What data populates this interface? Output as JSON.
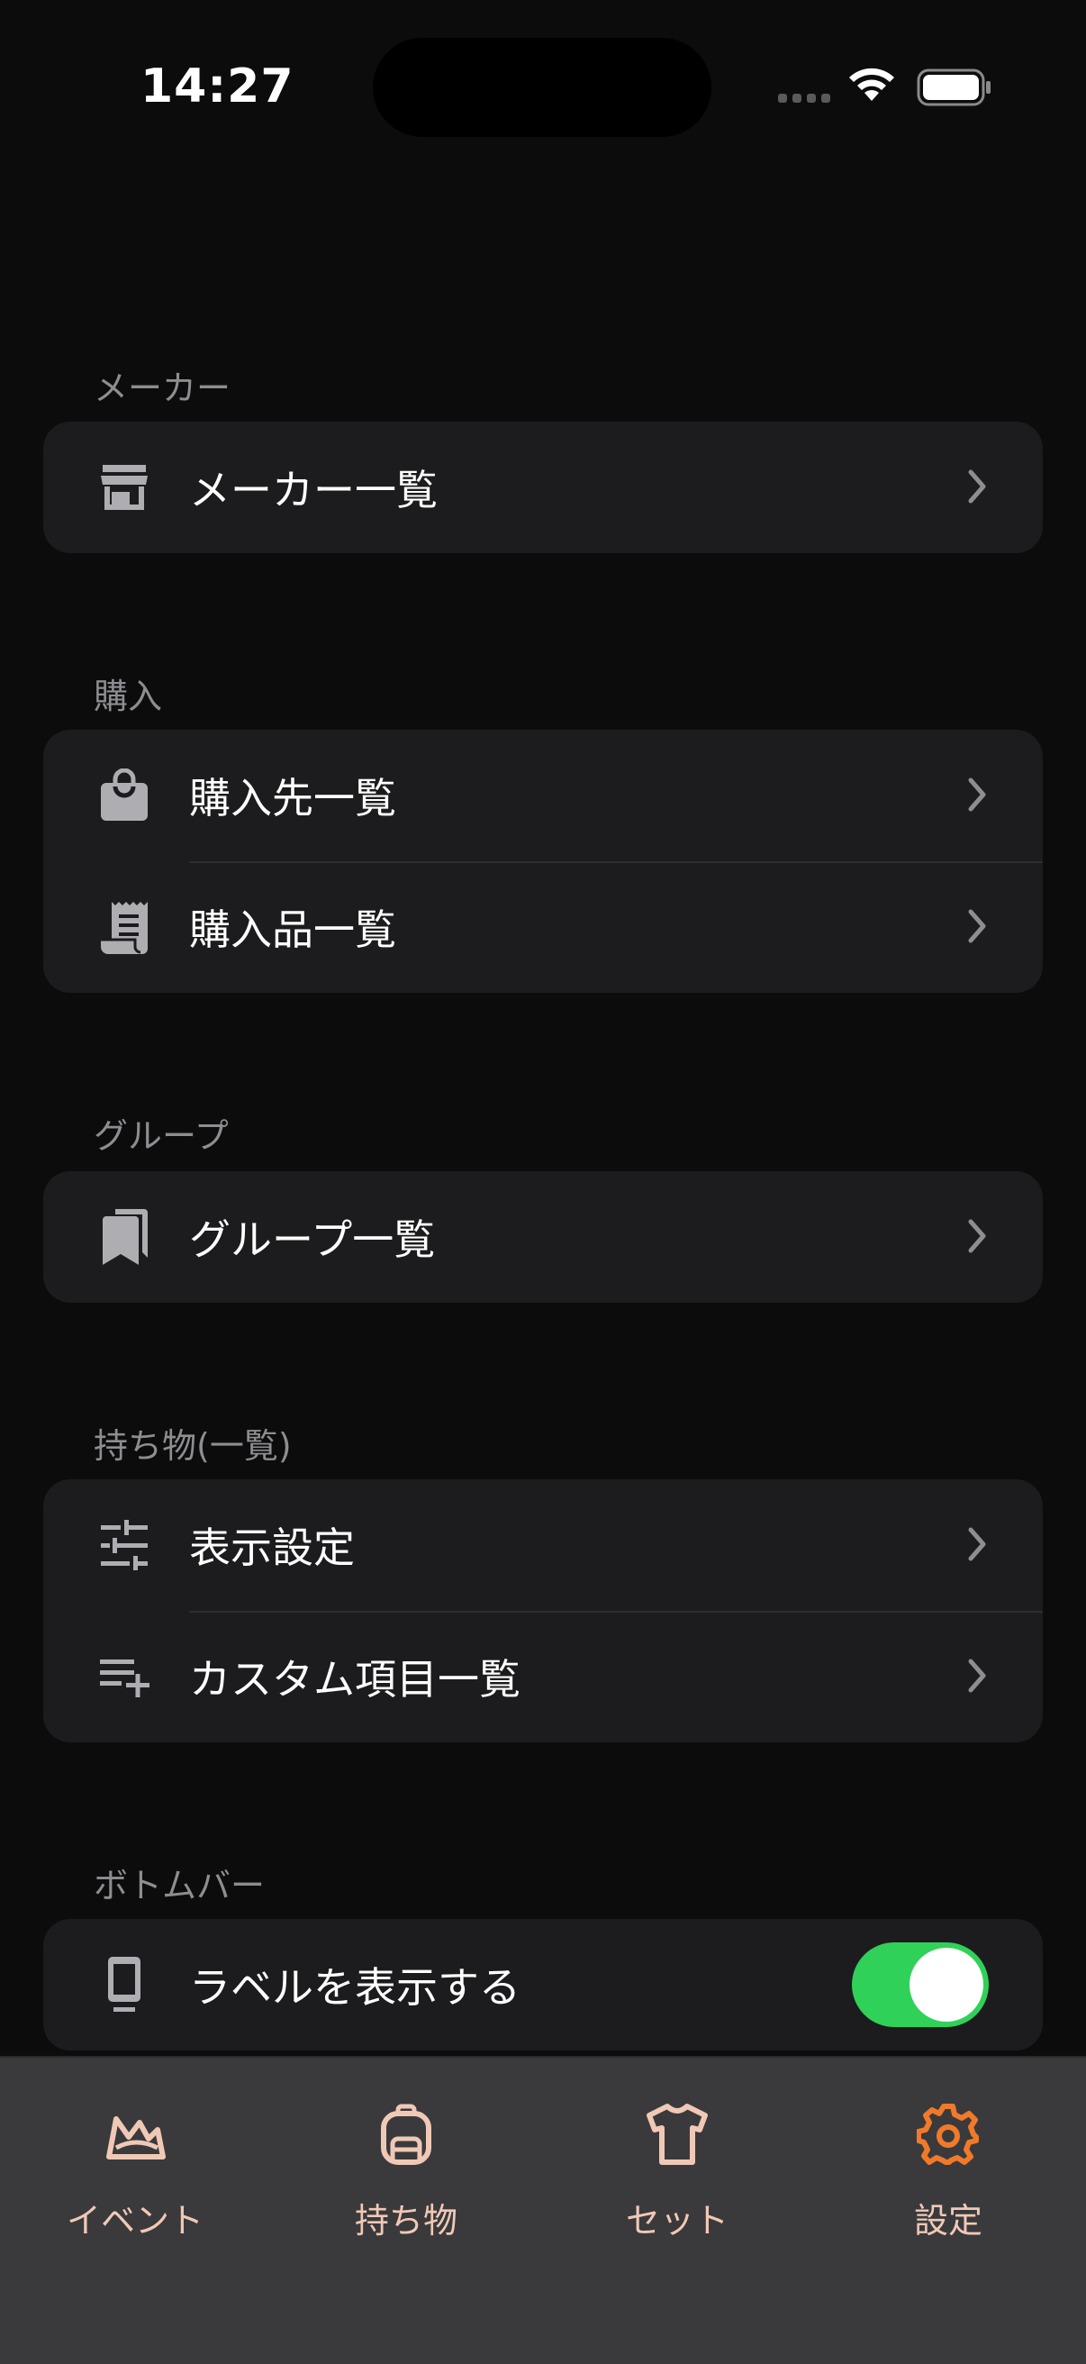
{
  "status_bar": {
    "time": "14:27"
  },
  "sections": [
    {
      "label": "メーカー",
      "items": [
        {
          "icon": "store-icon",
          "label": "メーカー一覧"
        }
      ]
    },
    {
      "label": "購入",
      "items": [
        {
          "icon": "shopping-bag-icon",
          "label": "購入先一覧"
        },
        {
          "icon": "receipt-icon",
          "label": "購入品一覧"
        }
      ]
    },
    {
      "label": "グループ",
      "items": [
        {
          "icon": "bookmarks-icon",
          "label": "グループ一覧"
        }
      ]
    },
    {
      "label": "持ち物(一覧)",
      "items": [
        {
          "icon": "sliders-icon",
          "label": "表示設定"
        },
        {
          "icon": "playlist-add-icon",
          "label": "カスタム項目一覧"
        }
      ]
    },
    {
      "label": "ボトムバー",
      "items": [
        {
          "icon": "phone-icon",
          "label": "ラベルを表示する",
          "toggle": true
        }
      ]
    }
  ],
  "tab_bar": {
    "tabs": [
      {
        "label": "イベント",
        "icon": "crown-icon",
        "active": false
      },
      {
        "label": "持ち物",
        "icon": "backpack-icon",
        "active": false
      },
      {
        "label": "セット",
        "icon": "shirt-icon",
        "active": false
      },
      {
        "label": "設定",
        "icon": "gear-icon",
        "active": true
      }
    ]
  },
  "colors": {
    "background": "#0c0c0c",
    "card": "#1c1c1e",
    "toggle_on": "#30d158",
    "tab_inactive": "#f0c9b6",
    "tab_active": "#f07a2a"
  }
}
